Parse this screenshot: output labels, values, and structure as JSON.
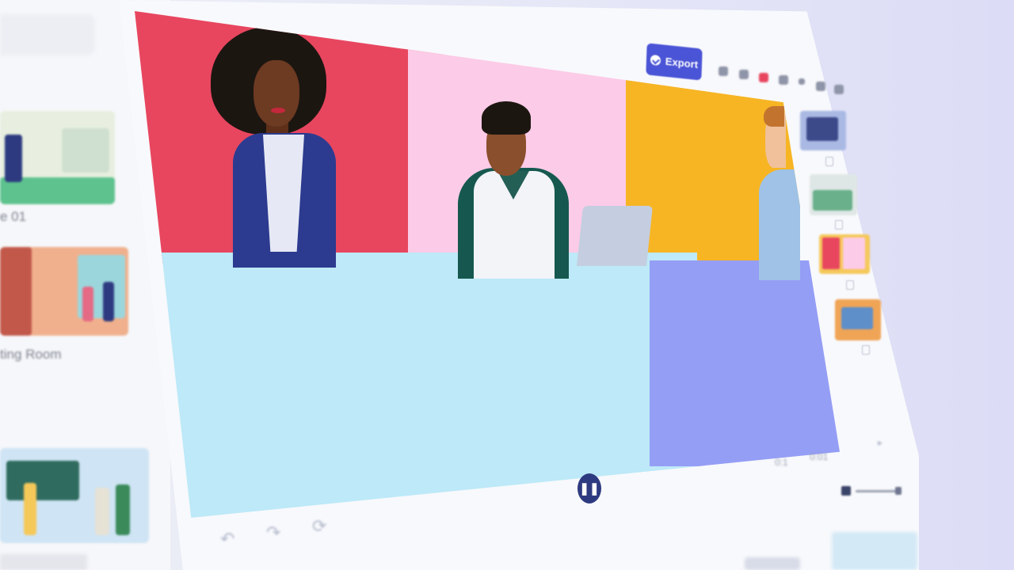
{
  "sidebar": {
    "templates": [
      {
        "label": "e 01",
        "palette": [
          "#e7efdf",
          "#6cc79a",
          "#2d3a80"
        ]
      },
      {
        "label": "ting Room",
        "palette": [
          "#f0b08d",
          "#9bd6dc",
          "#c2584a"
        ]
      },
      {
        "label": "",
        "palette": [
          "#cfe4f4",
          "#2f6b5e",
          "#f5c85a"
        ]
      }
    ]
  },
  "toolbar": {
    "export_label": "Export",
    "icons": [
      "duplicate-icon",
      "copy-icon",
      "delete-icon",
      "user-icon",
      "grid-icon",
      "lock-icon",
      "more-icon"
    ]
  },
  "canvas": {
    "colors": {
      "red": "#e8465f",
      "pink": "#fccbe7",
      "yellow": "#f7b524",
      "cyan": "#bde9f8",
      "violet": "#959ef5"
    }
  },
  "controls": {
    "undo_icon": "↶",
    "redo_icon": "↷",
    "reset_icon": "⟳",
    "pause_icon": "❚❚",
    "zoom_value": "0:1",
    "speed_value": "0:01"
  },
  "colors": {
    "accent": "#4a54d6",
    "pause": "#2e3a80"
  }
}
